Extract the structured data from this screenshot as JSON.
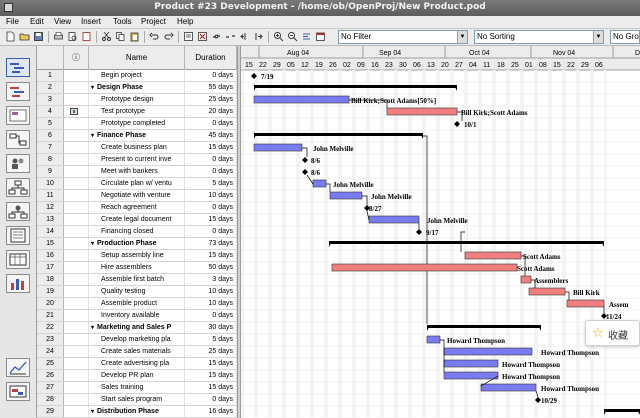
{
  "window": {
    "title": "Product #23 Development - /home/ob/OpenProj/New Product.pod"
  },
  "menu": [
    "File",
    "Edit",
    "View",
    "Insert",
    "Tools",
    "Project",
    "Help"
  ],
  "toolbar": {
    "filter": "No Filter",
    "sorting": "No Sorting",
    "grouping": "No Gro"
  },
  "table": {
    "columns": {
      "indicator": "ⓘ",
      "name": "Name",
      "duration": "Duration"
    },
    "rows": [
      {
        "id": "1",
        "name": "Begin project",
        "duration": "0 days",
        "summary": false,
        "indent": 1
      },
      {
        "id": "2",
        "name": "Design Phase",
        "duration": "55 days",
        "summary": true,
        "indent": 0
      },
      {
        "id": "3",
        "name": "Prototype design",
        "duration": "25 days",
        "summary": false,
        "indent": 1
      },
      {
        "id": "4",
        "name": "Test prototype",
        "duration": "20 days",
        "summary": false,
        "indent": 1,
        "note": true
      },
      {
        "id": "5",
        "name": "Prototype completed",
        "duration": "0 days",
        "summary": false,
        "indent": 1
      },
      {
        "id": "6",
        "name": "Finance Phase",
        "duration": "45 days",
        "summary": true,
        "indent": 0
      },
      {
        "id": "7",
        "name": "Create business plan",
        "duration": "15 days",
        "summary": false,
        "indent": 1
      },
      {
        "id": "8",
        "name": "Present to current inve",
        "duration": "0 days",
        "summary": false,
        "indent": 1
      },
      {
        "id": "9",
        "name": "Meet with bankers",
        "duration": "0 days",
        "summary": false,
        "indent": 1
      },
      {
        "id": "10",
        "name": "Circulate plan w/ ventu",
        "duration": "5 days",
        "summary": false,
        "indent": 1
      },
      {
        "id": "11",
        "name": "Negotiate with venture",
        "duration": "10 days",
        "summary": false,
        "indent": 1
      },
      {
        "id": "12",
        "name": "Reach agreement",
        "duration": "0 days",
        "summary": false,
        "indent": 1
      },
      {
        "id": "13",
        "name": "Create legal document",
        "duration": "15 days",
        "summary": false,
        "indent": 1
      },
      {
        "id": "14",
        "name": "Financing closed",
        "duration": "0 days",
        "summary": false,
        "indent": 1
      },
      {
        "id": "15",
        "name": "Production Phase",
        "duration": "73 days",
        "summary": true,
        "indent": 0
      },
      {
        "id": "16",
        "name": "Setup assembly line",
        "duration": "15 days",
        "summary": false,
        "indent": 1
      },
      {
        "id": "17",
        "name": "Hire assemblers",
        "duration": "50 days",
        "summary": false,
        "indent": 1
      },
      {
        "id": "18",
        "name": "Assemble first batch",
        "duration": "3 days",
        "summary": false,
        "indent": 1
      },
      {
        "id": "19",
        "name": "Quality testing",
        "duration": "10 days",
        "summary": false,
        "indent": 1
      },
      {
        "id": "20",
        "name": "Assemble product",
        "duration": "10 days",
        "summary": false,
        "indent": 1
      },
      {
        "id": "21",
        "name": "Inventory available",
        "duration": "0 days",
        "summary": false,
        "indent": 1
      },
      {
        "id": "22",
        "name": "Marketing and Sales P",
        "duration": "30 days",
        "summary": true,
        "indent": 0
      },
      {
        "id": "23",
        "name": "Develop marketing pla",
        "duration": "5 days",
        "summary": false,
        "indent": 1
      },
      {
        "id": "24",
        "name": "Create sales materials",
        "duration": "25 days",
        "summary": false,
        "indent": 1
      },
      {
        "id": "25",
        "name": "Create advertising pla",
        "duration": "15 days",
        "summary": false,
        "indent": 1
      },
      {
        "id": "26",
        "name": "Develop PR plan",
        "duration": "15 days",
        "summary": false,
        "indent": 1
      },
      {
        "id": "27",
        "name": "Sales training",
        "duration": "15 days",
        "summary": false,
        "indent": 1
      },
      {
        "id": "28",
        "name": "Start sales program",
        "duration": "0 days",
        "summary": false,
        "indent": 1
      },
      {
        "id": "29",
        "name": "Distribution Phase",
        "duration": "16 days",
        "summary": true,
        "indent": 0
      }
    ]
  },
  "gantt": {
    "months": [
      "Aug 04",
      "Sep 04",
      "Oct 04",
      "Nov 04",
      "Dec"
    ],
    "days": [
      "15",
      "22",
      "29",
      "05",
      "12",
      "19",
      "26",
      "02",
      "09",
      "16",
      "23",
      "30",
      "06",
      "13",
      "20",
      "27",
      "04",
      "11",
      "18",
      "25",
      "01",
      "08",
      "15",
      "22",
      "29",
      "06"
    ],
    "labels": {
      "r1": "7/19",
      "r3": "Bill Kirk;Scott Adams[50%]",
      "r4": "Bill Kirk;Scott Adams",
      "r5": "10/1",
      "r7": "John Melville",
      "r8": "8/6",
      "r9": "8/6",
      "r10": "John Melville",
      "r11": "John Melville",
      "r12": "8/27",
      "r13": "John Melville",
      "r14": "9/17",
      "r16": "Scott Adams",
      "r17": "Scott Adams",
      "r18": "Assemblers",
      "r19": "Bill Kirk",
      "r20": "Assem",
      "r21": "11/24",
      "r23": "Howard Thompson",
      "r24": "Howard Thompson",
      "r25": "Howard Thompson",
      "r26": "Howard Thompson",
      "r27": "Howard Thompson",
      "r28": "10/29"
    },
    "colors": {
      "task_blue": "#7b7bf0",
      "task_red": "#f08080",
      "summary": "#000000",
      "milestone": "#000000"
    }
  },
  "favorite": {
    "star": "☆",
    "label": "收藏"
  }
}
